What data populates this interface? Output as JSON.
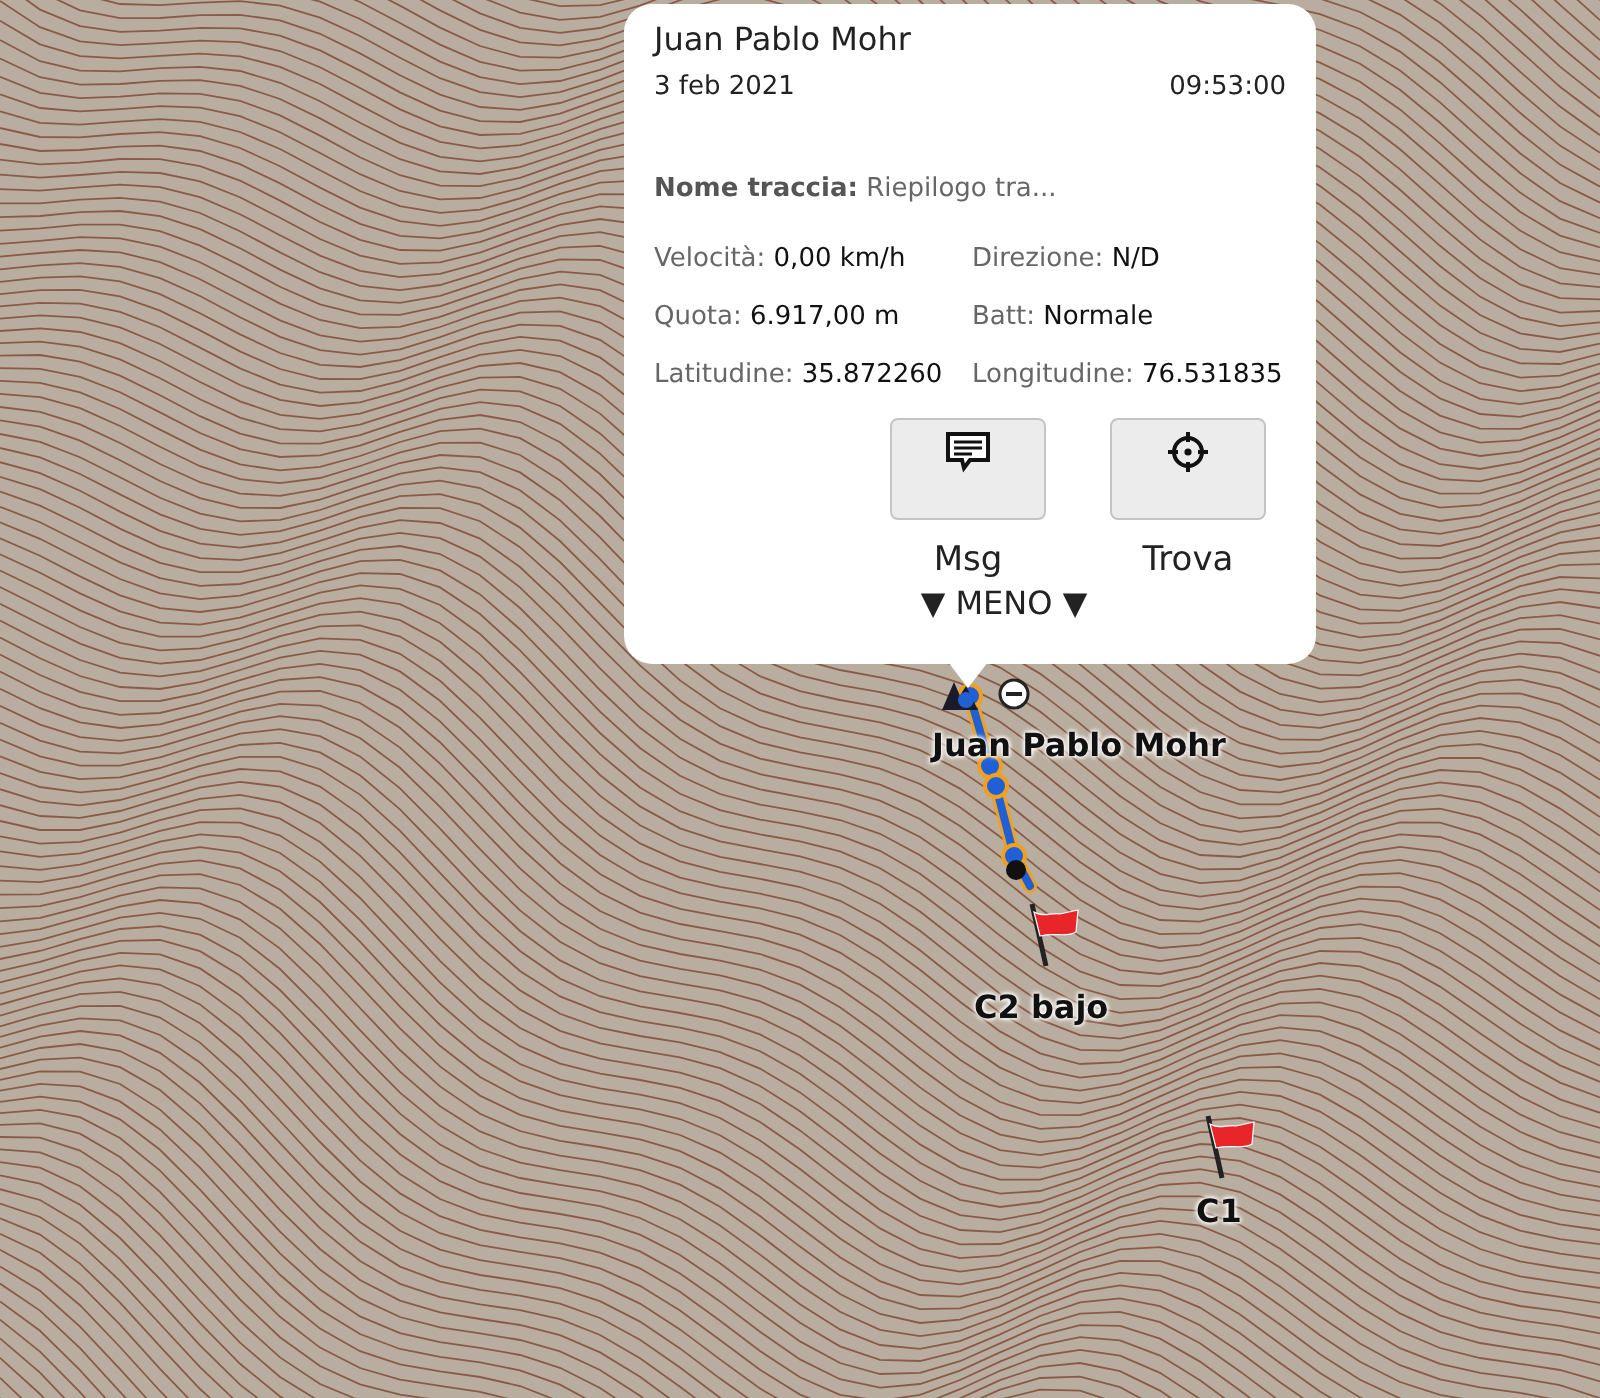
{
  "popup": {
    "title": "Juan Pablo Mohr",
    "date": "3 feb 2021",
    "time": "09:53:00",
    "track": {
      "label": "Nome traccia:",
      "value": "Riepilogo tra..."
    },
    "fields": [
      {
        "label": "Velocità:",
        "value": "0,00 km/h"
      },
      {
        "label": "Direzione:",
        "value": "N/D"
      },
      {
        "label": "Quota:",
        "value": "6.917,00 m"
      },
      {
        "label": "Batt:",
        "value": "Normale"
      },
      {
        "label": "Latitudine:",
        "value": "35.872260"
      },
      {
        "label": "Longitudine:",
        "value": "76.531835"
      }
    ],
    "buttons": [
      {
        "kind": "message",
        "label": "Msg"
      },
      {
        "kind": "locate",
        "label": "Trova"
      }
    ],
    "toggle": "▼ MENO ▼"
  },
  "markers": [
    {
      "kind": "person",
      "label": "Juan Pablo Mohr"
    },
    {
      "kind": "flag",
      "label": "C2 bajo"
    },
    {
      "kind": "flag",
      "label": "C1"
    }
  ]
}
